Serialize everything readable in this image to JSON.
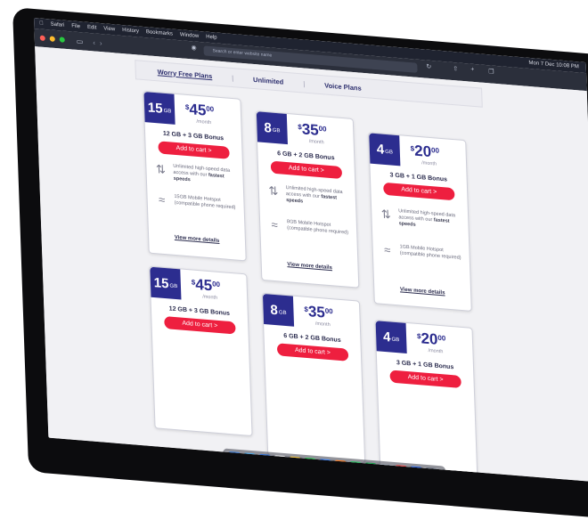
{
  "menubar": {
    "items": [
      "Safari",
      "File",
      "Edit",
      "View",
      "History",
      "Bookmarks",
      "Window",
      "Help"
    ],
    "clock": "Mon 7 Dec 10:08 PM"
  },
  "browser": {
    "url": "Search or enter website name",
    "traffic_lights": [
      "#ff5f57",
      "#febc2e",
      "#28c840"
    ]
  },
  "nav": {
    "tabs": [
      "Worry Free Plans",
      "Unlimited",
      "Voice Plans"
    ],
    "separator": "|"
  },
  "cards": [
    {
      "gb": "15",
      "unit": "GB",
      "currency": "$",
      "dollars": "45",
      "cents": "00",
      "per": "/month",
      "bonus": "12 GB + 3 GB Bonus",
      "cta": "Add to cart >",
      "speed_text": "Unlimited high-speed data access with our",
      "speed_bold": "fastest speeds",
      "hotspot_text": "15GB Mobile Hotspot (compatible phone required)",
      "more": "View more details"
    },
    {
      "gb": "8",
      "unit": "GB",
      "currency": "$",
      "dollars": "35",
      "cents": "00",
      "per": "/month",
      "bonus": "6 GB + 2 GB Bonus",
      "cta": "Add to cart >",
      "speed_text": "Unlimited high-speed data access with our",
      "speed_bold": "fastest speeds",
      "hotspot_text": "8GB Mobile Hotspot (compatible phone required)",
      "more": "View more details"
    },
    {
      "gb": "4",
      "unit": "GB",
      "currency": "$",
      "dollars": "20",
      "cents": "00",
      "per": "/month",
      "bonus": "3 GB + 1 GB Bonus",
      "cta": "Add to cart >",
      "speed_text": "Unlimited high-speed data access with our",
      "speed_bold": "fastest speeds",
      "hotspot_text": "1GB Mobile Hotspot (compatible phone required)",
      "more": "View more details"
    },
    {
      "gb": "15",
      "unit": "GB",
      "currency": "$",
      "dollars": "45",
      "cents": "00",
      "per": "/month",
      "bonus": "12 GB + 3 GB Bonus",
      "cta": "Add to cart >"
    },
    {
      "gb": "8",
      "unit": "GB",
      "currency": "$",
      "dollars": "35",
      "cents": "00",
      "per": "/month",
      "bonus": "6 GB + 2 GB Bonus",
      "cta": "Add to cart >"
    },
    {
      "gb": "4",
      "unit": "GB",
      "currency": "$",
      "dollars": "20",
      "cents": "00",
      "per": "/month",
      "bonus": "3 GB + 1 GB Bonus",
      "cta": "Add to cart >"
    }
  ],
  "colors": {
    "brand": "#2c2d8f",
    "cta": "#ee1f3f"
  },
  "dock": {
    "apps": [
      "#3a7bd5",
      "#4aa3df",
      "#2f6fd6",
      "#e8e8e8",
      "#f4c542",
      "#34c759",
      "#3b82f6",
      "#f97316",
      "#22c55e",
      "#16a34a",
      "#9ca3af",
      "#ef4444",
      "#2563eb",
      "#6b7280"
    ]
  }
}
